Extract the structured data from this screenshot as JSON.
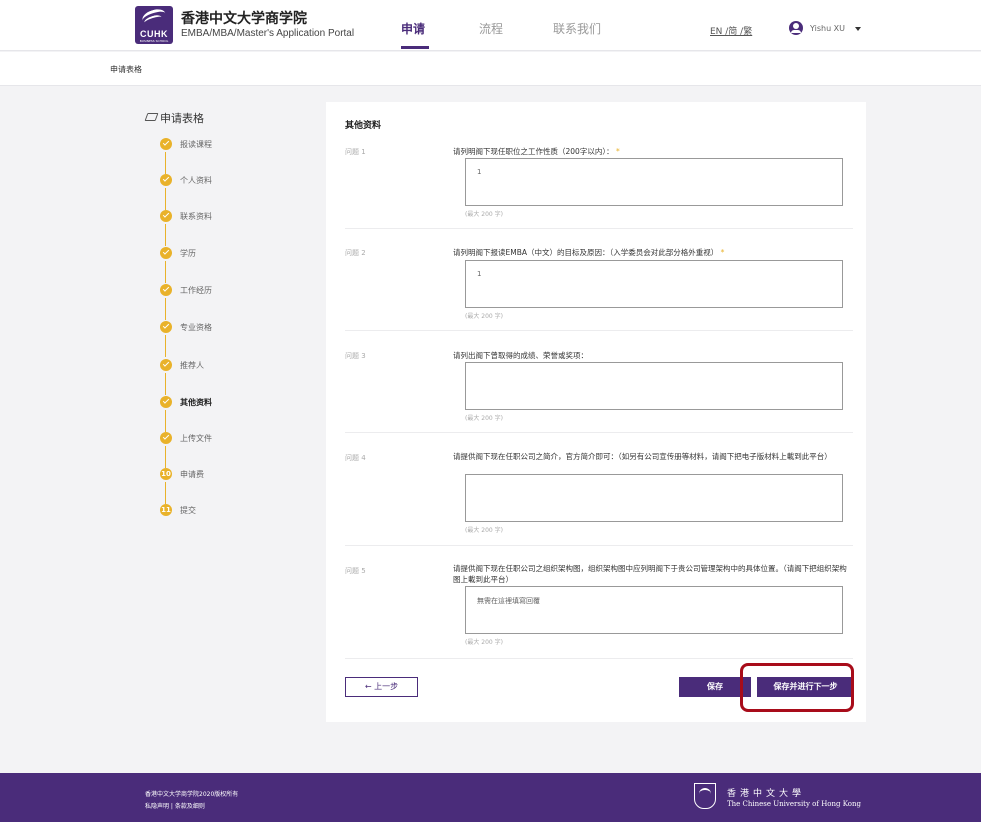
{
  "header": {
    "brand_title": "香港中文大学商学院",
    "brand_subtitle": "EMBA/MBA/Master's Application Portal",
    "logo_text": "CUHK",
    "logo_subtext": "BUSINESS SCHOOL",
    "nav": [
      "申请",
      "流程",
      "联系我们"
    ],
    "language": "EN /简 /繁",
    "user_name": "Yishu XU"
  },
  "breadcrumb": "申请表格",
  "sidebar": {
    "title": "申请表格",
    "steps": [
      {
        "label": "报读课程",
        "status": "done"
      },
      {
        "label": "个人资料",
        "status": "done"
      },
      {
        "label": "联系资料",
        "status": "done"
      },
      {
        "label": "学历",
        "status": "done"
      },
      {
        "label": "工作经历",
        "status": "done"
      },
      {
        "label": "专业资格",
        "status": "done"
      },
      {
        "label": "推荐人",
        "status": "done"
      },
      {
        "label": "其他资料",
        "status": "current"
      },
      {
        "label": "上传文件",
        "status": "done"
      },
      {
        "label": "申请费",
        "status": "pending",
        "number": "10"
      },
      {
        "label": "提交",
        "status": "pending",
        "number": "11"
      }
    ]
  },
  "form": {
    "title": "其他资料",
    "questions": [
      {
        "number": "问题 1",
        "text": "请列明阁下现任职位之工作性质（200字以内）：",
        "required_mark": "*",
        "value": "1",
        "hint": "(最大 200 字)"
      },
      {
        "number": "问题 2",
        "text": "请列明阁下报读EMBA（中文）的目标及原因：（入学委员会对此部分格外重视）",
        "required_mark": "*",
        "value": "1",
        "hint": "(最大 200 字)"
      },
      {
        "number": "问题 3",
        "text": "请列出阁下曾取得的成绩、荣誉或奖项：",
        "required_mark": "",
        "value": "",
        "hint": "(最大 200 字)"
      },
      {
        "number": "问题 4",
        "text": "请提供阁下现在任职公司之简介，官方简介即可：（如另有公司宣传册等材料，请阁下把电子版材料上載到此平台）",
        "required_mark": "",
        "value": "",
        "hint": "(最大 200 字)"
      },
      {
        "number": "问题 5",
        "text": "请提供阁下现在任职公司之组织架构图，组织架构图中应列明阁下于贵公司管理架构中的具体位置。（请阁下把组织架构图上載到此平台）",
        "required_mark": "",
        "value": "無需在這裡填寫回覆",
        "hint": "(最大 200 字)"
      }
    ],
    "back_label": "← 上一步",
    "save_label": "保存",
    "next_label": "保存并进行下一步"
  },
  "footer": {
    "copyright": "香港中文大学商学院2020版权所有",
    "links": "私隐声明 | 条款及细则",
    "university_cn": "香港中文大學",
    "university_en": "The Chinese University of Hong Kong"
  },
  "colors": {
    "brand_purple": "#4a2c7a",
    "step_gold": "#e9b22a",
    "highlight_red": "#a80c1a"
  }
}
